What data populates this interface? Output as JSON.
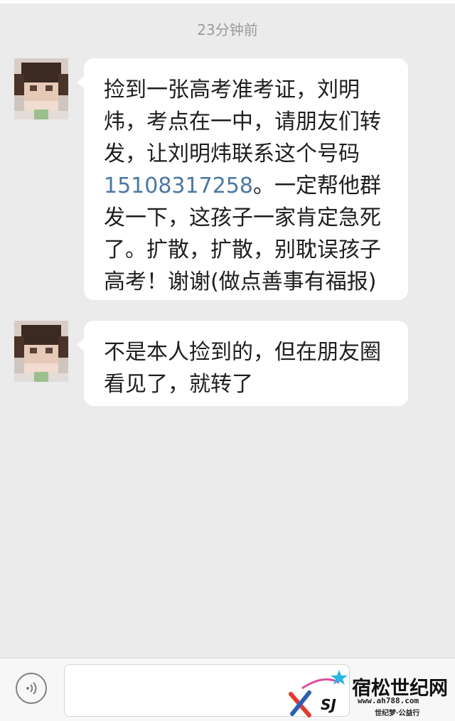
{
  "chat": {
    "timestamp": "23分钟前",
    "messages": [
      {
        "text_before": "捡到一张高考准考证，刘明炜，考点在一中，请朋友们转发，让刘明炜联系这个号码",
        "phone": "15108317258",
        "text_after": "。一定帮他群发一下，这孩子一家肯定急死了。扩散，扩散，别耽误孩子高考！谢谢(做点善事有福报)"
      },
      {
        "text": "不是本人捡到的，但在朋友圈看见了，就转了"
      }
    ]
  },
  "input_bar": {
    "voice_icon": "voice-input-icon",
    "input_value": ""
  },
  "watermark": {
    "title": "宿松世纪网",
    "url": "www.ah788.com",
    "slogan": "世纪梦·公益行",
    "logo_letters": "SJ"
  },
  "colors": {
    "background": "#ebebeb",
    "bubble": "#ffffff",
    "phone_link": "#4a78a3",
    "timestamp": "#9a9a9a"
  }
}
